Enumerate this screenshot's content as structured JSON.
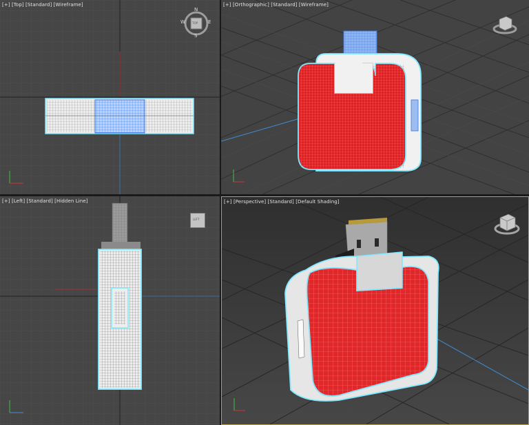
{
  "viewports": {
    "top": {
      "label": "[+] [Top] [Standard] [Wireframe]",
      "compass": {
        "north": "N",
        "south": "S",
        "east": "E",
        "west": "W",
        "cube_face": "TOP"
      }
    },
    "ortho": {
      "label": "[+] [Orthographic] [Standard] [Wireframe]"
    },
    "left": {
      "label": "[+] [Left] [Standard] [Hidden Line]",
      "cube_face": "LEFT"
    },
    "persp": {
      "label": "[+] [Perspective] [Standard] [Default Shading]"
    }
  },
  "colors": {
    "viewport_bg": "#444444",
    "grid_minor": "#4f4f4f",
    "grid_major": "#2e2e2e",
    "selection_outline": "#7fe9ff",
    "red_body": "#e0282b",
    "wire_blue": "#5b9bff",
    "active_border": "#b5a24b"
  }
}
